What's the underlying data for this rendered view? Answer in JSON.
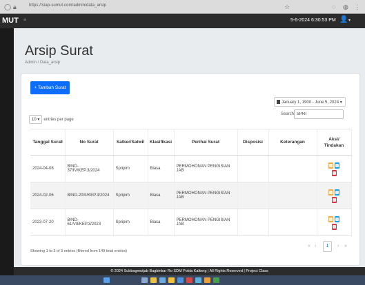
{
  "browser": {
    "url": "https://siap-sumut.com/admin/data_arsip",
    "icons": [
      "back-icon",
      "lock-icon",
      "star-icon",
      "extension-icon",
      "profile-icon",
      "menu-icon"
    ]
  },
  "navbar": {
    "brand": "MUT",
    "menu_toggle": "≡",
    "datetime": "5-6-2024 6:30:53 PM",
    "user_glyph": "👤",
    "chevron": "▾"
  },
  "page": {
    "title": "Arsip Surat",
    "breadcrumb": "Admin / Data_arsip"
  },
  "toolbar": {
    "add_label": "+ Tambah Surat",
    "date_range": "January 1, 1900 - June 5, 2024 ▾",
    "search_label": "Search:",
    "search_value": "SPRI",
    "entries_value": "10",
    "entries_caret": "▾",
    "entries_suffix": "entries per page"
  },
  "table": {
    "headers": {
      "tanggal": "Tanggal Surat",
      "no_surat": "No Surat",
      "satker": "Satker/Satwil",
      "klasifikasi": "Klasifikasi",
      "perihal": "Perihal Surat",
      "disposisi": "Disposisi",
      "keterangan": "Keterangan",
      "aksi": "Aksi/ Tindakan"
    },
    "sort_arrow": "⇅",
    "rows": [
      {
        "tanggal": "2024-04-08",
        "no_surat": "B/ND-37/IV/KEP.3/2024",
        "satker": "Spripim",
        "klasifikasi": "Biasa",
        "perihal": "PERMOHONAN PENGISIAN JAB",
        "disposisi": "",
        "keterangan": ""
      },
      {
        "tanggal": "2024-02-06",
        "no_surat": "B/ND-20/II/KEP.3/2024",
        "satker": "Spripim",
        "klasifikasi": "Biasa",
        "perihal": "PERMOHONAN PENGISIAN JAB",
        "disposisi": "",
        "keterangan": ""
      },
      {
        "tanggal": "2023-07-20",
        "no_surat": "B/ND-61/VII/KEP.3/2023",
        "satker": "Spripim",
        "klasifikasi": "Biasa",
        "perihal": "PERMOHONAN PENGISIAN JAB",
        "disposisi": "",
        "keterangan": ""
      }
    ]
  },
  "info": "Showing 1 to 3 of 3 entries (filtered from 149 total entries)",
  "pagination": {
    "first": "«",
    "prev": "‹",
    "current": "1",
    "next": "›",
    "last": "»"
  },
  "footer": "© 2024 Subbagmutjab Bagbinkar Ro SDM Polda Kalteng | All Rights Reserved | Project Class",
  "colors": {
    "primary": "#0d6efd",
    "edit": "#f0ad4e",
    "view": "#17a2e8",
    "delete": "#dc3545",
    "navbar": "#2b2b2b"
  }
}
